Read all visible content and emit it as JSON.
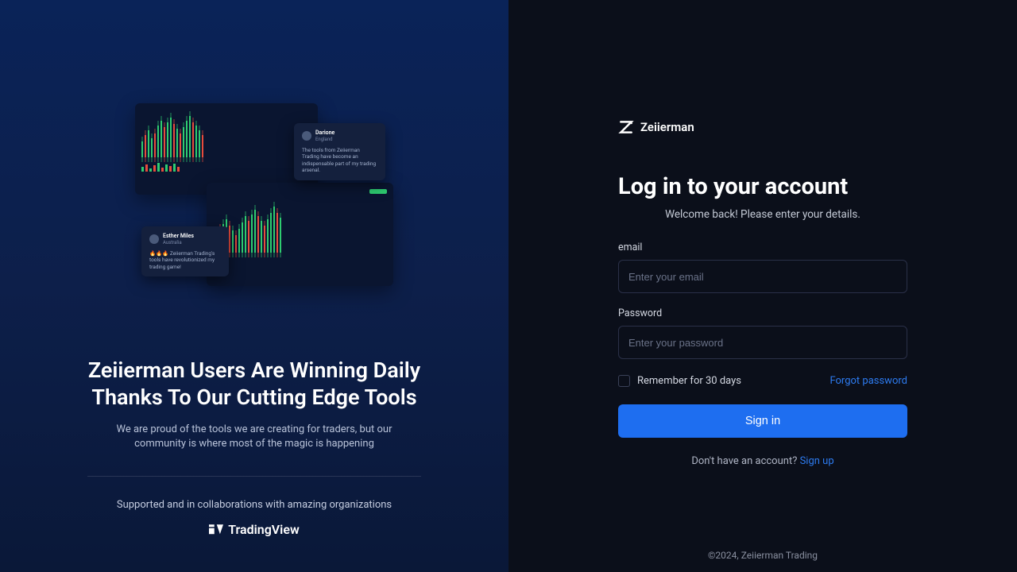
{
  "marketing": {
    "headline": "Zeiierman Users Are Winning Daily Thanks To Our Cutting Edge Tools",
    "subtext": "We are proud of the tools we are creating for traders, but our community is where most of the magic is happening",
    "supported_label": "Supported and in collaborations with amazing organizations",
    "partner_name": "TradingView"
  },
  "testimonials": {
    "t1_name": "Darione",
    "t1_location": "England",
    "t1_text": "The tools from Zeiierman Trading have become an indispensable part of my trading arsenal.",
    "t2_name": "Esther Miles",
    "t2_location": "Australia",
    "t2_text": "🔥🔥🔥 Zeiierman Trading's tools have revolutionized my trading game!"
  },
  "brand": {
    "name": "Zeiierman"
  },
  "login": {
    "title": "Log in to your account",
    "subtitle": "Welcome back! Please enter your details.",
    "email_label": "email",
    "email_placeholder": "Enter your email",
    "password_label": "Password",
    "password_placeholder": "Enter your password",
    "remember_label": "Remember for 30 days",
    "forgot_label": "Forgot password",
    "submit_label": "Sign in",
    "no_account_text": "Don't have an account? ",
    "signup_label": "Sign up"
  },
  "footer": {
    "copyright": "©2024, Zeiierman Trading"
  }
}
